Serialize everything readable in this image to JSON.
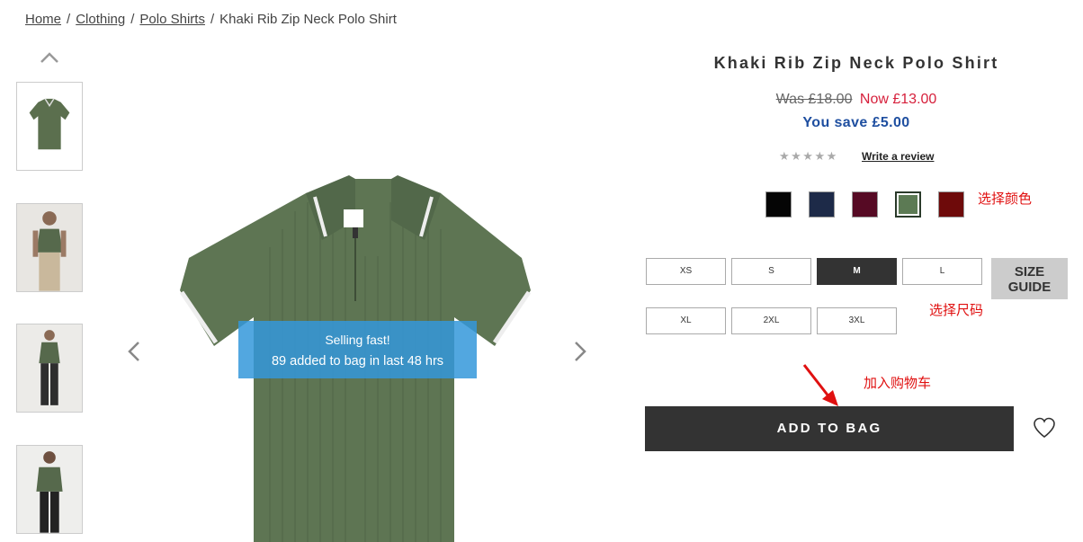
{
  "breadcrumb": {
    "items": [
      "Home",
      "Clothing",
      "Polo Shirts"
    ],
    "separator": "/",
    "current": "Khaki Rib Zip Neck Polo Shirt"
  },
  "gallery": {
    "thumbnails": [
      "polo-flat-thumbnail",
      "model-front-thumbnail",
      "model-full-thumbnail",
      "model-back-thumbnail"
    ],
    "badge_line1": "Selling fast!",
    "badge_line2": "89 added to bag in last 48 hrs"
  },
  "product": {
    "title": "Khaki Rib Zip Neck Polo Shirt",
    "was_price": "Was £18.00",
    "now_price": "Now £13.00",
    "savings": "You save £5.00",
    "review_link": "Write a review",
    "stars": "★★★★★",
    "rating_stars": 0
  },
  "colors": {
    "swatches": [
      "#050505",
      "#1d2a48",
      "#560a24",
      "#5c7a54",
      "#6e0a0a"
    ],
    "selected_index": 3,
    "annotation": "选择颜色"
  },
  "sizes": {
    "options": [
      "XS",
      "S",
      "M",
      "L",
      "XL",
      "2XL",
      "3XL"
    ],
    "selected": "M",
    "guide_line1": "SIZE",
    "guide_line2": "GUIDE",
    "annotation": "选择尺码"
  },
  "actions": {
    "add_to_bag": "ADD TO BAG",
    "annotation": "加入购物车"
  },
  "theme": {
    "price_now": "#d61f3b",
    "savings": "#1f4fa0",
    "annotation_red": "#e01010",
    "badge_blue": "#3498db"
  }
}
